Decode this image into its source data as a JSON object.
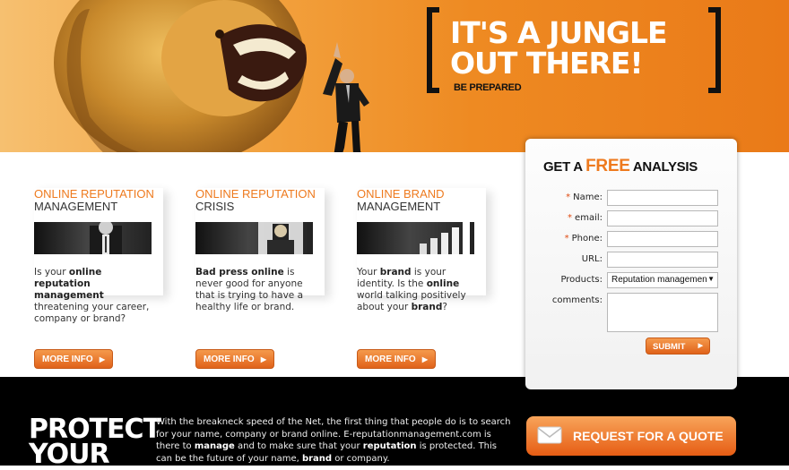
{
  "hero": {
    "slogan_line1": "IT'S A JUNGLE",
    "slogan_line2": "OUT THERE!",
    "slogan_sub": "BE PREPARED"
  },
  "features": [
    {
      "title_line1": "ONLINE REPUTATION",
      "title_line2": "MANAGEMENT",
      "text_a": "Is your ",
      "text_b": "online reputation management",
      "text_c": " threatening your career, company or brand?",
      "button": "MORE INFO"
    },
    {
      "title_line1": "ONLINE REPUTATION",
      "title_line2": "CRISIS",
      "text_a": "Bad press online",
      "text_b": " is never good for anyone that is trying to have a healthy life or brand.",
      "button": "MORE INFO"
    },
    {
      "title_line1": "ONLINE BRAND",
      "title_line2": "MANAGEMENT",
      "text_a": "Your ",
      "text_b": "brand",
      "text_c": " is your identity. Is the ",
      "text_d": "online",
      "text_e": " world talking positively about your ",
      "text_f": "brand",
      "text_g": "?",
      "button": "MORE INFO"
    }
  ],
  "form": {
    "title_a": "GET A ",
    "title_free": "FREE",
    "title_b": " ANALYSIS",
    "fields": {
      "name_label": "Name:",
      "email_label": "email:",
      "phone_label": "Phone:",
      "url_label": "URL:",
      "products_label": "Products:",
      "comments_label": "comments:",
      "required_mark": "*"
    },
    "products_selected": "Reputation managemen",
    "submit": "SUBMIT"
  },
  "band": {
    "protect_line1": "PROTECT",
    "protect_line2": "YOUR",
    "text_1": "With the breakneck speed of the Net, the first thing that people do is to search for your name, company or brand online. E-reputationmanagement.com is there to ",
    "bold_manage": "manage",
    "text_2": " and to make sure that your ",
    "bold_reputation": "reputation",
    "text_3": " is protected. This can be the future of your name, ",
    "bold_brand": "brand",
    "text_4": " or company.",
    "quote_button": "REQUEST FOR A QUOTE"
  },
  "colors": {
    "accent": "#ee7a1e",
    "band": "#000000"
  },
  "icons": {
    "arrow": "arrow-right-icon",
    "envelope": "envelope-icon",
    "dropdown": "chevron-down-icon"
  }
}
